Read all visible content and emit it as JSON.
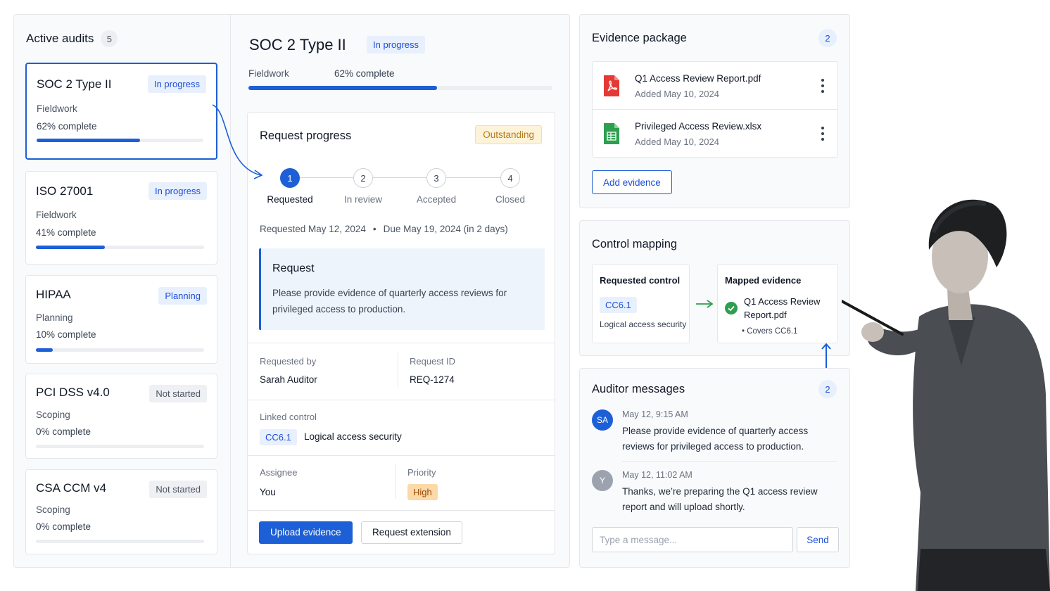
{
  "audits": {
    "title": "Active audits",
    "count": "5",
    "items": [
      {
        "name": "SOC 2 Type II",
        "status": "In progress",
        "phase": "Fieldwork",
        "percent_label": "62% complete",
        "progress": 0.62
      },
      {
        "name": "ISO 27001",
        "status": "In progress",
        "phase": "Fieldwork",
        "percent_label": "41% complete",
        "progress": 0.41
      },
      {
        "name": "HIPAA",
        "status": "Planning",
        "phase": "Planning",
        "percent_label": "10% complete",
        "progress": 0.1
      },
      {
        "name": "PCI DSS v4.0",
        "status": "Not started",
        "phase": "Scoping",
        "percent_label": "0% complete",
        "progress": 0
      },
      {
        "name": "CSA CCM v4",
        "status": "Not started",
        "phase": "Scoping",
        "percent_label": "0% complete",
        "progress": 0
      }
    ]
  },
  "detail": {
    "title": "SOC 2 Type II",
    "status": "In progress",
    "phase": "Fieldwork",
    "percent_label": "62% complete",
    "progress": 0.62
  },
  "request": {
    "title": "Request progress",
    "badge": "Outstanding",
    "steps": [
      {
        "num": "1",
        "label": "Requested"
      },
      {
        "num": "2",
        "label": "In review"
      },
      {
        "num": "3",
        "label": "Accepted"
      },
      {
        "num": "4",
        "label": "Closed"
      }
    ],
    "current_step": 1,
    "requested_date": "Requested May 12, 2024",
    "separator": "•",
    "due_date": "Due May 19, 2024 (in 2 days)",
    "box_title": "Request",
    "box_text": "Please provide evidence of quarterly access reviews for privileged access to production.",
    "requested_by_label": "Requested by",
    "requested_by": "Sarah Auditor",
    "request_id_label": "Request ID",
    "request_id": "REQ-1274",
    "linked_control_label": "Linked control",
    "control_code": "CC6.1",
    "control_name": "Logical access security",
    "assignee_label": "Assignee",
    "assignee": "You",
    "priority_label": "Priority",
    "priority": "High",
    "upload_button": "Upload evidence",
    "extension_button": "Request extension"
  },
  "evidence": {
    "title": "Evidence package",
    "count": "2",
    "files": [
      {
        "name": "Q1 Access Review Report.pdf",
        "added": "Added May 10, 2024",
        "icon": "pdf-file-icon",
        "color": "#e53935"
      },
      {
        "name": "Privileged Access Review.xlsx",
        "added": "Added May 10, 2024",
        "icon": "spreadsheet-file-icon",
        "color": "#2e9e4f"
      }
    ],
    "add_button": "Add evidence"
  },
  "mapping": {
    "title": "Control mapping",
    "requested_title": "Requested control",
    "control_code": "CC6.1",
    "control_name": "Logical access security",
    "mapped_title": "Mapped evidence",
    "mapped_file_line1": "Q1 Access Review",
    "mapped_file_line2": "Report.pdf",
    "covers": "• Covers CC6.1"
  },
  "messages": {
    "title": "Auditor messages",
    "count": "2",
    "items": [
      {
        "initials": "SA",
        "time": "May 12, 9:15 AM",
        "text": "Please provide evidence of quarterly access reviews for privileged access to production.",
        "avatar_color": "#1d5fd6"
      },
      {
        "initials": "Y",
        "time": "May 12, 11:02 AM",
        "text": "Thanks, we’re preparing the Q1 access review report and will upload shortly.",
        "avatar_color": "#9ca3af"
      }
    ],
    "input_placeholder": "Type a message...",
    "send_button": "Send"
  },
  "colors": {
    "accent": "#1d5fd6",
    "outstanding": "#b7791f",
    "priority_high": "#fbd9a8",
    "success": "#2e9e4f"
  }
}
